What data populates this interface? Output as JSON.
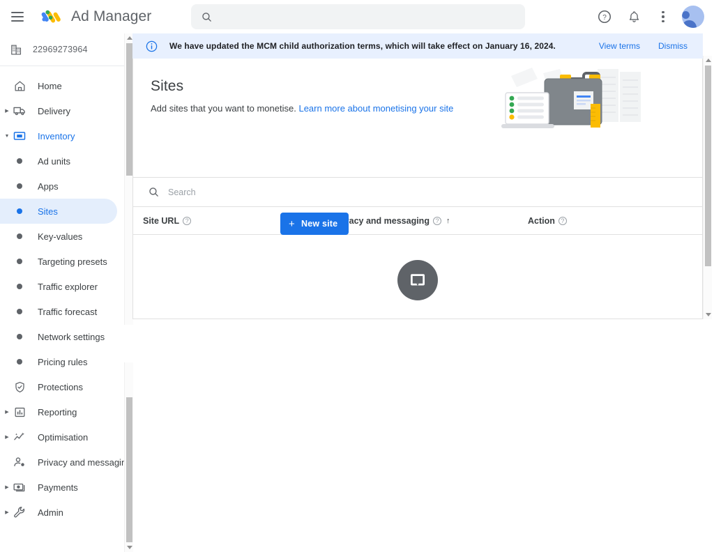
{
  "header": {
    "menu_icon": "hamburger-menu-icon",
    "logo_icon": "ad-manager-logo",
    "title": "Ad Manager",
    "search": {
      "value": "",
      "placeholder": "",
      "icon": "search-icon"
    },
    "help_icon": "help-circle-icon",
    "notifications_icon": "bell-icon",
    "more_icon": "more-vertical-icon",
    "avatar_icon": "account-avatar"
  },
  "sidebar": {
    "account": {
      "icon": "network-building-icon",
      "id": "22969273964"
    },
    "items": [
      {
        "label": "Home",
        "icon": "home-icon",
        "kind": "top",
        "expandable": false,
        "state": ""
      },
      {
        "label": "Delivery",
        "icon": "truck-icon",
        "kind": "top",
        "expandable": true,
        "state": ""
      },
      {
        "label": "Inventory",
        "icon": "inventory-icon",
        "kind": "top",
        "expandable": true,
        "state": "expanded"
      },
      {
        "label": "Ad units",
        "icon": "bullet-dot",
        "kind": "child",
        "expandable": false,
        "state": ""
      },
      {
        "label": "Apps",
        "icon": "bullet-dot",
        "kind": "child",
        "expandable": false,
        "state": ""
      },
      {
        "label": "Sites",
        "icon": "bullet-dot",
        "kind": "child",
        "expandable": false,
        "state": "selected"
      },
      {
        "label": "Key-values",
        "icon": "bullet-dot",
        "kind": "child",
        "expandable": false,
        "state": ""
      },
      {
        "label": "Targeting presets",
        "icon": "bullet-dot",
        "kind": "child",
        "expandable": false,
        "state": ""
      },
      {
        "label": "Traffic explorer",
        "icon": "bullet-dot",
        "kind": "child",
        "expandable": false,
        "state": ""
      },
      {
        "label": "Traffic forecast",
        "icon": "bullet-dot",
        "kind": "child",
        "expandable": false,
        "state": ""
      },
      {
        "label": "Network settings",
        "icon": "bullet-dot",
        "kind": "child",
        "expandable": false,
        "state": ""
      },
      {
        "label": "Pricing rules",
        "icon": "bullet-dot",
        "kind": "child",
        "expandable": false,
        "state": ""
      },
      {
        "label": "Protections",
        "icon": "shield-icon",
        "kind": "top",
        "expandable": false,
        "state": ""
      },
      {
        "label": "Reporting",
        "icon": "bar-chart-icon",
        "kind": "top",
        "expandable": true,
        "state": ""
      },
      {
        "label": "Optimisation",
        "icon": "optimisation-icon",
        "kind": "top",
        "expandable": true,
        "state": ""
      },
      {
        "label": "Privacy and messaging",
        "icon": "person-check-icon",
        "kind": "top",
        "expandable": false,
        "state": ""
      },
      {
        "label": "Payments",
        "icon": "banknote-icon",
        "kind": "top",
        "expandable": true,
        "state": ""
      },
      {
        "label": "Admin",
        "icon": "wrench-icon",
        "kind": "top",
        "expandable": true,
        "state": ""
      }
    ]
  },
  "notice": {
    "icon": "info-circle-icon",
    "text": "We have updated the MCM child authorization terms, which will take effect on January 16, 2024.",
    "view_terms_label": "View terms",
    "dismiss_label": "Dismiss"
  },
  "page": {
    "title": "Sites",
    "subtitle_prefix": "Add sites that you want to monetise.",
    "subtitle_link": "Learn more about monetising your site",
    "illustration": "briefcase-documents-illustration",
    "new_site_button": {
      "label": "New site",
      "icon": "plus-icon"
    }
  },
  "table": {
    "search": {
      "value": "",
      "placeholder": "Search",
      "icon": "search-icon"
    },
    "columns": [
      {
        "label": "Site URL",
        "help": "?",
        "sorted": false,
        "sort_dir": ""
      },
      {
        "label": "Privacy and messaging",
        "help": "?",
        "sorted": true,
        "sort_dir": "↑"
      },
      {
        "label": "Action",
        "help": "?",
        "sorted": false,
        "sort_dir": ""
      }
    ],
    "rows": [],
    "empty_state": {
      "icon": "no-sites-icon",
      "label": ""
    }
  },
  "colors": {
    "accent": "#1a73e8",
    "notice_bg": "#e8f0fe",
    "selected_bg": "#e4eefc",
    "text": "#3c4043",
    "muted": "#5f6368"
  }
}
